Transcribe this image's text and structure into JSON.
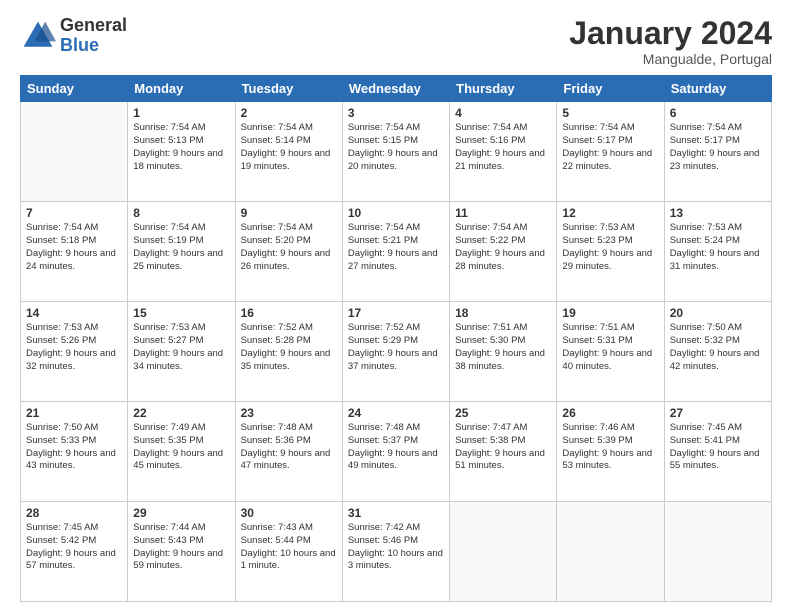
{
  "header": {
    "logo_general": "General",
    "logo_blue": "Blue",
    "month_title": "January 2024",
    "location": "Mangualde, Portugal"
  },
  "days_of_week": [
    "Sunday",
    "Monday",
    "Tuesday",
    "Wednesday",
    "Thursday",
    "Friday",
    "Saturday"
  ],
  "weeks": [
    [
      {
        "day": "",
        "empty": true
      },
      {
        "day": "1",
        "sunrise": "Sunrise: 7:54 AM",
        "sunset": "Sunset: 5:13 PM",
        "daylight": "Daylight: 9 hours and 18 minutes."
      },
      {
        "day": "2",
        "sunrise": "Sunrise: 7:54 AM",
        "sunset": "Sunset: 5:14 PM",
        "daylight": "Daylight: 9 hours and 19 minutes."
      },
      {
        "day": "3",
        "sunrise": "Sunrise: 7:54 AM",
        "sunset": "Sunset: 5:15 PM",
        "daylight": "Daylight: 9 hours and 20 minutes."
      },
      {
        "day": "4",
        "sunrise": "Sunrise: 7:54 AM",
        "sunset": "Sunset: 5:16 PM",
        "daylight": "Daylight: 9 hours and 21 minutes."
      },
      {
        "day": "5",
        "sunrise": "Sunrise: 7:54 AM",
        "sunset": "Sunset: 5:17 PM",
        "daylight": "Daylight: 9 hours and 22 minutes."
      },
      {
        "day": "6",
        "sunrise": "Sunrise: 7:54 AM",
        "sunset": "Sunset: 5:17 PM",
        "daylight": "Daylight: 9 hours and 23 minutes."
      }
    ],
    [
      {
        "day": "7",
        "sunrise": "Sunrise: 7:54 AM",
        "sunset": "Sunset: 5:18 PM",
        "daylight": "Daylight: 9 hours and 24 minutes."
      },
      {
        "day": "8",
        "sunrise": "Sunrise: 7:54 AM",
        "sunset": "Sunset: 5:19 PM",
        "daylight": "Daylight: 9 hours and 25 minutes."
      },
      {
        "day": "9",
        "sunrise": "Sunrise: 7:54 AM",
        "sunset": "Sunset: 5:20 PM",
        "daylight": "Daylight: 9 hours and 26 minutes."
      },
      {
        "day": "10",
        "sunrise": "Sunrise: 7:54 AM",
        "sunset": "Sunset: 5:21 PM",
        "daylight": "Daylight: 9 hours and 27 minutes."
      },
      {
        "day": "11",
        "sunrise": "Sunrise: 7:54 AM",
        "sunset": "Sunset: 5:22 PM",
        "daylight": "Daylight: 9 hours and 28 minutes."
      },
      {
        "day": "12",
        "sunrise": "Sunrise: 7:53 AM",
        "sunset": "Sunset: 5:23 PM",
        "daylight": "Daylight: 9 hours and 29 minutes."
      },
      {
        "day": "13",
        "sunrise": "Sunrise: 7:53 AM",
        "sunset": "Sunset: 5:24 PM",
        "daylight": "Daylight: 9 hours and 31 minutes."
      }
    ],
    [
      {
        "day": "14",
        "sunrise": "Sunrise: 7:53 AM",
        "sunset": "Sunset: 5:26 PM",
        "daylight": "Daylight: 9 hours and 32 minutes."
      },
      {
        "day": "15",
        "sunrise": "Sunrise: 7:53 AM",
        "sunset": "Sunset: 5:27 PM",
        "daylight": "Daylight: 9 hours and 34 minutes."
      },
      {
        "day": "16",
        "sunrise": "Sunrise: 7:52 AM",
        "sunset": "Sunset: 5:28 PM",
        "daylight": "Daylight: 9 hours and 35 minutes."
      },
      {
        "day": "17",
        "sunrise": "Sunrise: 7:52 AM",
        "sunset": "Sunset: 5:29 PM",
        "daylight": "Daylight: 9 hours and 37 minutes."
      },
      {
        "day": "18",
        "sunrise": "Sunrise: 7:51 AM",
        "sunset": "Sunset: 5:30 PM",
        "daylight": "Daylight: 9 hours and 38 minutes."
      },
      {
        "day": "19",
        "sunrise": "Sunrise: 7:51 AM",
        "sunset": "Sunset: 5:31 PM",
        "daylight": "Daylight: 9 hours and 40 minutes."
      },
      {
        "day": "20",
        "sunrise": "Sunrise: 7:50 AM",
        "sunset": "Sunset: 5:32 PM",
        "daylight": "Daylight: 9 hours and 42 minutes."
      }
    ],
    [
      {
        "day": "21",
        "sunrise": "Sunrise: 7:50 AM",
        "sunset": "Sunset: 5:33 PM",
        "daylight": "Daylight: 9 hours and 43 minutes."
      },
      {
        "day": "22",
        "sunrise": "Sunrise: 7:49 AM",
        "sunset": "Sunset: 5:35 PM",
        "daylight": "Daylight: 9 hours and 45 minutes."
      },
      {
        "day": "23",
        "sunrise": "Sunrise: 7:48 AM",
        "sunset": "Sunset: 5:36 PM",
        "daylight": "Daylight: 9 hours and 47 minutes."
      },
      {
        "day": "24",
        "sunrise": "Sunrise: 7:48 AM",
        "sunset": "Sunset: 5:37 PM",
        "daylight": "Daylight: 9 hours and 49 minutes."
      },
      {
        "day": "25",
        "sunrise": "Sunrise: 7:47 AM",
        "sunset": "Sunset: 5:38 PM",
        "daylight": "Daylight: 9 hours and 51 minutes."
      },
      {
        "day": "26",
        "sunrise": "Sunrise: 7:46 AM",
        "sunset": "Sunset: 5:39 PM",
        "daylight": "Daylight: 9 hours and 53 minutes."
      },
      {
        "day": "27",
        "sunrise": "Sunrise: 7:45 AM",
        "sunset": "Sunset: 5:41 PM",
        "daylight": "Daylight: 9 hours and 55 minutes."
      }
    ],
    [
      {
        "day": "28",
        "sunrise": "Sunrise: 7:45 AM",
        "sunset": "Sunset: 5:42 PM",
        "daylight": "Daylight: 9 hours and 57 minutes."
      },
      {
        "day": "29",
        "sunrise": "Sunrise: 7:44 AM",
        "sunset": "Sunset: 5:43 PM",
        "daylight": "Daylight: 9 hours and 59 minutes."
      },
      {
        "day": "30",
        "sunrise": "Sunrise: 7:43 AM",
        "sunset": "Sunset: 5:44 PM",
        "daylight": "Daylight: 10 hours and 1 minute."
      },
      {
        "day": "31",
        "sunrise": "Sunrise: 7:42 AM",
        "sunset": "Sunset: 5:46 PM",
        "daylight": "Daylight: 10 hours and 3 minutes."
      },
      {
        "day": "",
        "empty": true
      },
      {
        "day": "",
        "empty": true
      },
      {
        "day": "",
        "empty": true
      }
    ]
  ]
}
